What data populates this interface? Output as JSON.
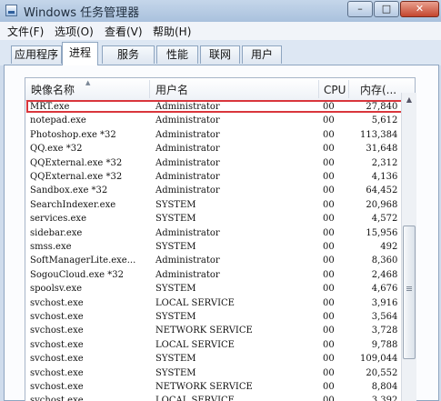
{
  "window": {
    "title": "Windows 任务管理器",
    "controls": {
      "minimize": "–",
      "maximize": "□",
      "close": "✕"
    }
  },
  "menu": {
    "items": [
      {
        "label": "文件(F)"
      },
      {
        "label": "选项(O)"
      },
      {
        "label": "查看(V)"
      },
      {
        "label": "帮助(H)"
      }
    ]
  },
  "tabs": [
    {
      "label": "应用程序"
    },
    {
      "label": "进程",
      "active": true
    },
    {
      "label": "服务"
    },
    {
      "label": "性能"
    },
    {
      "label": "联网"
    },
    {
      "label": "用户"
    }
  ],
  "table": {
    "columns": {
      "name": "映像名称",
      "user": "用户名",
      "cpu": "CPU",
      "memory": "内存(..."
    },
    "highlight_color": "#d9363c",
    "rows": [
      {
        "name": "MRT.exe",
        "user": "Administrator",
        "cpu": "00",
        "memory": "27,840 K",
        "highlighted": true
      },
      {
        "name": "notepad.exe",
        "user": "Administrator",
        "cpu": "00",
        "memory": "5,612 K"
      },
      {
        "name": "Photoshop.exe *32",
        "user": "Administrator",
        "cpu": "00",
        "memory": "113,384 K"
      },
      {
        "name": "QQ.exe *32",
        "user": "Administrator",
        "cpu": "00",
        "memory": "31,648 K"
      },
      {
        "name": "QQExternal.exe *32",
        "user": "Administrator",
        "cpu": "00",
        "memory": "2,312 K"
      },
      {
        "name": "QQExternal.exe *32",
        "user": "Administrator",
        "cpu": "00",
        "memory": "4,136 K"
      },
      {
        "name": "Sandbox.exe *32",
        "user": "Administrator",
        "cpu": "00",
        "memory": "64,452 K"
      },
      {
        "name": "SearchIndexer.exe",
        "user": "SYSTEM",
        "cpu": "00",
        "memory": "20,968 K"
      },
      {
        "name": "services.exe",
        "user": "SYSTEM",
        "cpu": "00",
        "memory": "4,572 K"
      },
      {
        "name": "sidebar.exe",
        "user": "Administrator",
        "cpu": "00",
        "memory": "15,956 K"
      },
      {
        "name": "smss.exe",
        "user": "SYSTEM",
        "cpu": "00",
        "memory": "492 K"
      },
      {
        "name": "SoftManagerLite.exe...",
        "user": "Administrator",
        "cpu": "00",
        "memory": "8,360 K"
      },
      {
        "name": "SogouCloud.exe *32",
        "user": "Administrator",
        "cpu": "00",
        "memory": "2,468 K"
      },
      {
        "name": "spoolsv.exe",
        "user": "SYSTEM",
        "cpu": "00",
        "memory": "4,676 K"
      },
      {
        "name": "svchost.exe",
        "user": "LOCAL SERVICE",
        "cpu": "00",
        "memory": "3,916 K"
      },
      {
        "name": "svchost.exe",
        "user": "SYSTEM",
        "cpu": "00",
        "memory": "3,564 K"
      },
      {
        "name": "svchost.exe",
        "user": "NETWORK SERVICE",
        "cpu": "00",
        "memory": "3,728 K"
      },
      {
        "name": "svchost.exe",
        "user": "LOCAL SERVICE",
        "cpu": "00",
        "memory": "9,788 K"
      },
      {
        "name": "svchost.exe",
        "user": "SYSTEM",
        "cpu": "00",
        "memory": "109,044 K"
      },
      {
        "name": "svchost.exe",
        "user": "SYSTEM",
        "cpu": "00",
        "memory": "20,552 K"
      },
      {
        "name": "svchost.exe",
        "user": "NETWORK SERVICE",
        "cpu": "00",
        "memory": "8,804 K"
      },
      {
        "name": "svchost.exe",
        "user": "LOCAL SERVICE",
        "cpu": "00",
        "memory": "3,392 K"
      }
    ]
  }
}
